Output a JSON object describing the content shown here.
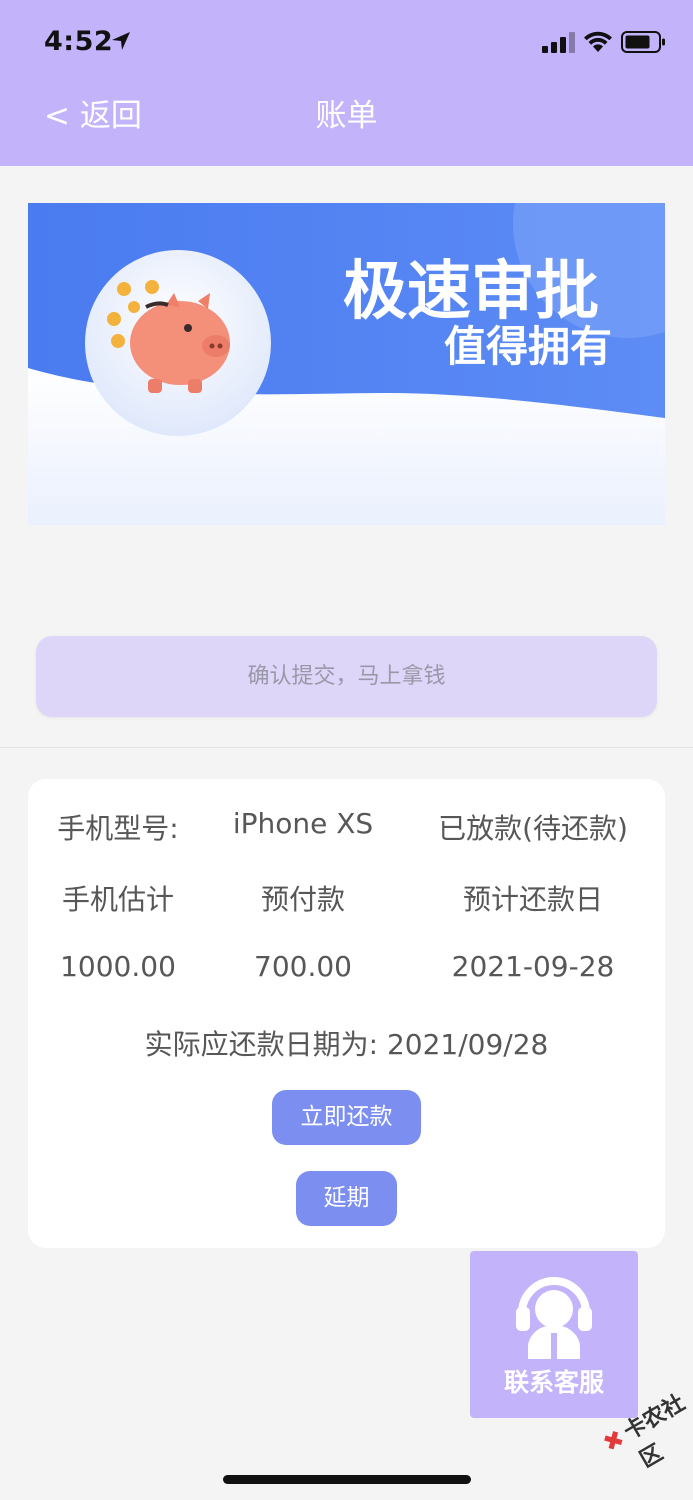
{
  "status_bar": {
    "time": "4:52"
  },
  "nav": {
    "back_label": "< 返回",
    "title": "账单"
  },
  "banner": {
    "headline": "极速审批",
    "subline": "值得拥有"
  },
  "confirm_button": "确认提交，马上拿钱",
  "bill": {
    "row1": [
      "手机型号:",
      "iPhone XS",
      "已放款(待还款)"
    ],
    "row2": [
      "手机估计",
      "预付款",
      "预计还款日"
    ],
    "row3": [
      "1000.00",
      "700.00",
      "2021-09-28"
    ],
    "due_text": "实际应还款日期为: 2021/09/28",
    "pay_button": "立即还款",
    "defer_button": "延期"
  },
  "customer_service": {
    "label": "联系客服"
  },
  "watermark": {
    "mark": "✖",
    "text": "卡农社区"
  },
  "colors": {
    "header_bg": "#c3b3fb",
    "banner_blue": "#4f7ff0",
    "button_blue": "#7c8ff0",
    "confirm_bg": "#ddd6f8"
  }
}
